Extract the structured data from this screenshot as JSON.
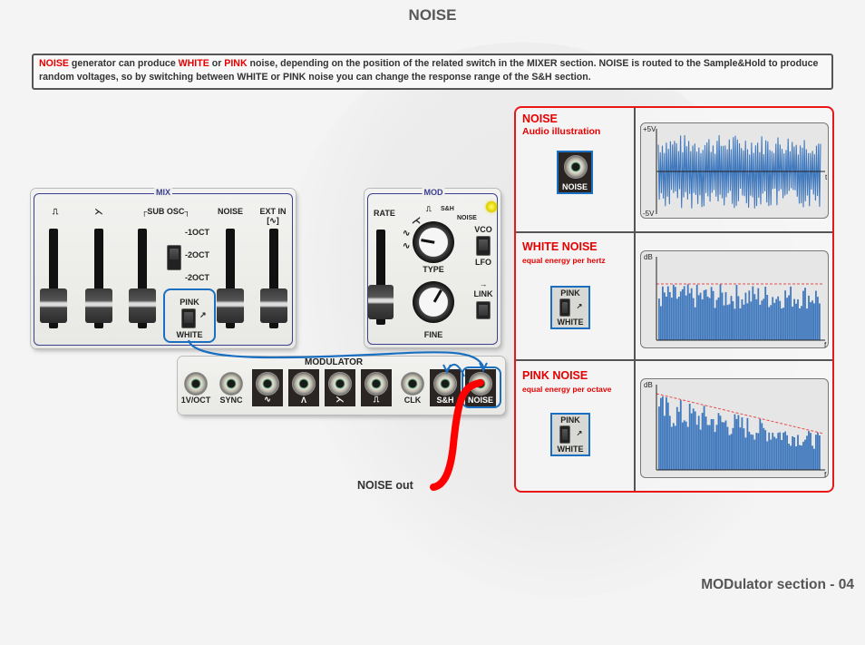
{
  "page": {
    "title": "NOISE",
    "footer": "MODulator section - 04"
  },
  "description": {
    "segments": [
      {
        "text": "NOISE",
        "highlight": true
      },
      {
        "text": " generator can produce ",
        "highlight": false
      },
      {
        "text": "WHITE",
        "highlight": true
      },
      {
        "text": " or ",
        "highlight": false
      },
      {
        "text": "PINK",
        "highlight": true
      },
      {
        "text": " noise, depending on the position of the related switch in the MIXER section. NOISE is routed to the Sample&Hold to produce random voltages, so by switching between WHITE or PINK noise you can change the response range of the S&H section.",
        "highlight": false
      }
    ],
    "highlight_color": "#e60000"
  },
  "mix_panel": {
    "label": "MIX",
    "channels": [
      "⎍",
      "⋋",
      "┌SUB OSC┐",
      "NOISE",
      "EXT IN"
    ],
    "ext_in_sub": "[∿]",
    "sub_osc_options": [
      "-1OCT",
      "-2OCT",
      "-2OCT"
    ],
    "noise_switch": {
      "top": "PINK",
      "bottom": "WHITE"
    }
  },
  "mod_panel": {
    "label": "MOD",
    "rate_label": "RATE",
    "type_knob_label": "TYPE",
    "fine_knob_label": "FINE",
    "type_options": [
      "∿",
      "∿",
      "⋌",
      "⎍",
      "S&H",
      "NOISE"
    ],
    "vco_lfo_switch": {
      "top": "VCO",
      "bottom": "LFO"
    },
    "link_label": "LINK",
    "link_arrow": "→"
  },
  "modulator": {
    "label": "MODULATOR",
    "jacks": [
      {
        "label": "1V/OCT",
        "dark": false
      },
      {
        "label": "SYNC",
        "dark": false
      },
      {
        "label": "∿",
        "dark": true
      },
      {
        "label": "Λ",
        "dark": true
      },
      {
        "label": "⋋",
        "dark": true
      },
      {
        "label": "⎍",
        "dark": true
      },
      {
        "label": "CLK",
        "dark": false
      },
      {
        "label": "S&H",
        "dark": true
      },
      {
        "label": "NOISE",
        "dark": true
      }
    ]
  },
  "noise_out": {
    "label": "NOISE out",
    "cable_color": "#ff0000"
  },
  "info_table": {
    "rows": [
      {
        "title": "NOISE",
        "subtitle": "Audio illustration",
        "thumb_label": "NOISE",
        "plot": {
          "type": "waveform",
          "y_top": "+5V",
          "y_bottom": "-5V",
          "x_label": "t"
        }
      },
      {
        "title": "WHITE NOISE",
        "subtitle": "equal energy per hertz",
        "switch": {
          "top": "PINK",
          "bottom": "WHITE"
        },
        "plot": {
          "type": "spectrum",
          "y_label": "dB",
          "x_label": "f",
          "envelope": "flat"
        }
      },
      {
        "title": "PINK NOISE",
        "subtitle": "equal energy per octave",
        "switch": {
          "top": "PINK",
          "bottom": "WHITE"
        },
        "plot": {
          "type": "spectrum",
          "y_label": "dB",
          "x_label": "f",
          "envelope": "falling"
        }
      }
    ],
    "border_color": "#e81818",
    "plot_color": "#3f78bd",
    "envelope_color": "#e84a4a"
  }
}
